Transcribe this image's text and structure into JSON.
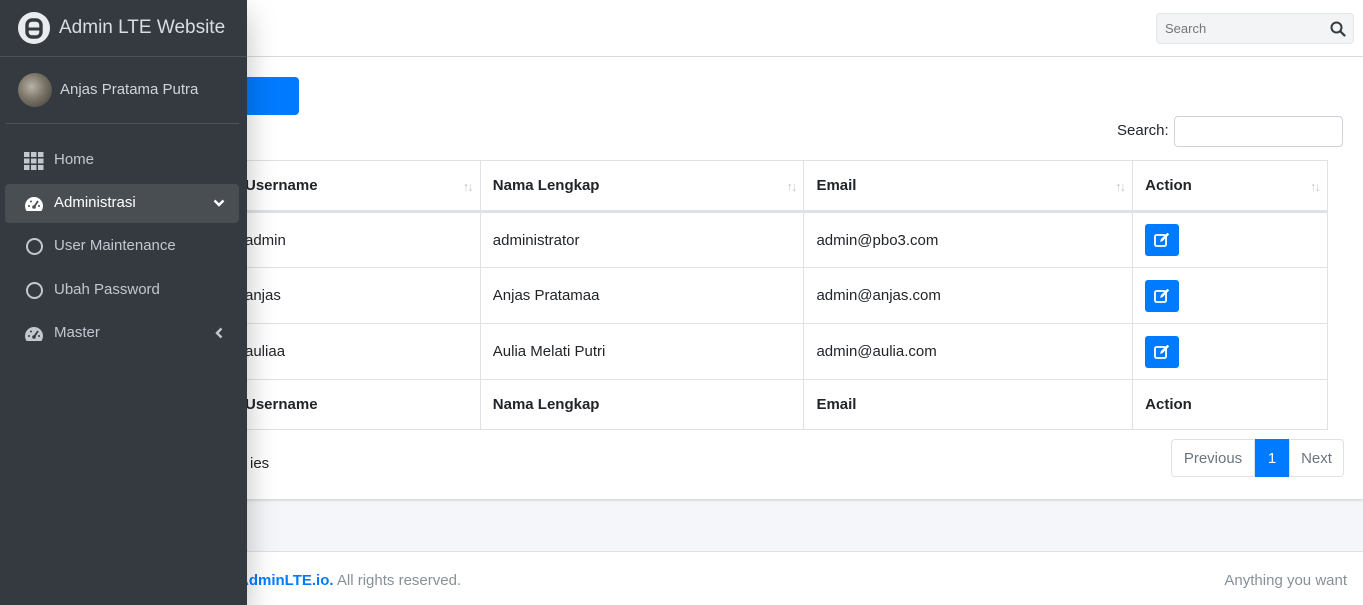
{
  "sidebar": {
    "brand": "Admin LTE Website",
    "user": "Anjas Pratama Putra",
    "items": [
      {
        "label": "Home",
        "icon": "grid-icon"
      },
      {
        "label": "Administrasi",
        "icon": "dashboard-icon",
        "active": true,
        "expanded": true
      },
      {
        "label": "User Maintenance",
        "icon": "circle-icon"
      },
      {
        "label": "Ubah Password",
        "icon": "circle-icon"
      },
      {
        "label": "Master",
        "icon": "dashboard-icon",
        "expanded": false
      }
    ]
  },
  "navbar": {
    "search_placeholder": "Search"
  },
  "datatable": {
    "search_label": "Search:",
    "headers": [
      "Username",
      "Nama Lengkap",
      "Email",
      "Action"
    ],
    "rows": [
      {
        "username": "admin",
        "nama": "administrator",
        "email": "admin@pbo3.com"
      },
      {
        "username": "anjas",
        "nama": "Anjas Pratamaa",
        "email": "admin@anjas.com"
      },
      {
        "username": "auliaa",
        "nama": "Aulia Melati Putri",
        "email": "admin@aulia.com"
      }
    ],
    "info_visible": "ies",
    "pagination": {
      "previous": "Previous",
      "current": "1",
      "next": "Next"
    }
  },
  "footer": {
    "brand": "AdminLTE.io.",
    "rights": " All rights reserved.",
    "right_text": "Anything you want"
  },
  "colors": {
    "sidebar_bg": "#343a40",
    "primary": "#007bff",
    "active_item": "#494e53"
  }
}
